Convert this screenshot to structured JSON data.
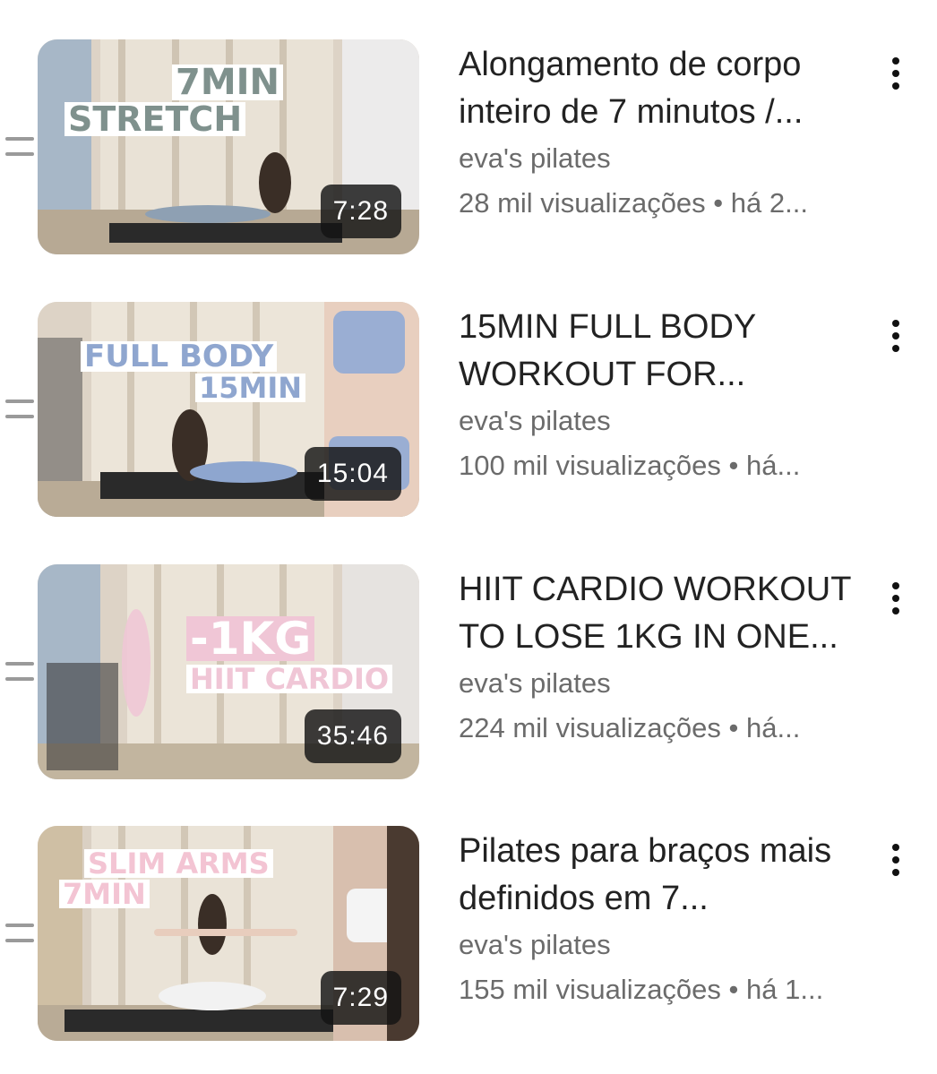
{
  "videos": [
    {
      "title": "Alongamento de corpo inteiro de 7 minutos /...",
      "channel": "eva's pilates",
      "views": "28 mil visualizações",
      "separator": "•",
      "age": "há 2...",
      "duration": "7:28",
      "overlay": [
        "7MIN",
        "STRETCH"
      ],
      "overlay_color": "#7f918d"
    },
    {
      "title": "15MIN FULL BODY WORKOUT FOR...",
      "channel": "eva's pilates",
      "views": "100 mil visualizações",
      "separator": "•",
      "age": "há...",
      "duration": "15:04",
      "overlay": [
        "FULL BODY",
        "15MIN"
      ],
      "overlay_color": "#8fa6cf"
    },
    {
      "title": "HIIT CARDIO WORKOUT TO LOSE 1KG IN ONE...",
      "channel": "eva's pilates",
      "views": "224 mil visualizações",
      "separator": "•",
      "age": "há...",
      "duration": "35:46",
      "overlay": [
        "-1KG",
        "HIIT CARDIO"
      ],
      "overlay_color": "#f0c6d6"
    },
    {
      "title": "Pilates para braços mais definidos em 7...",
      "channel": "eva's pilates",
      "views": "155 mil visualizações",
      "separator": "•",
      "age": "há 1...",
      "duration": "7:29",
      "overlay": [
        "SLIM ARMS",
        "7MIN"
      ],
      "overlay_color": "#f3c4d3"
    }
  ],
  "icons": {
    "drag": "drag-handle-icon",
    "more": "more-vertical-icon"
  }
}
